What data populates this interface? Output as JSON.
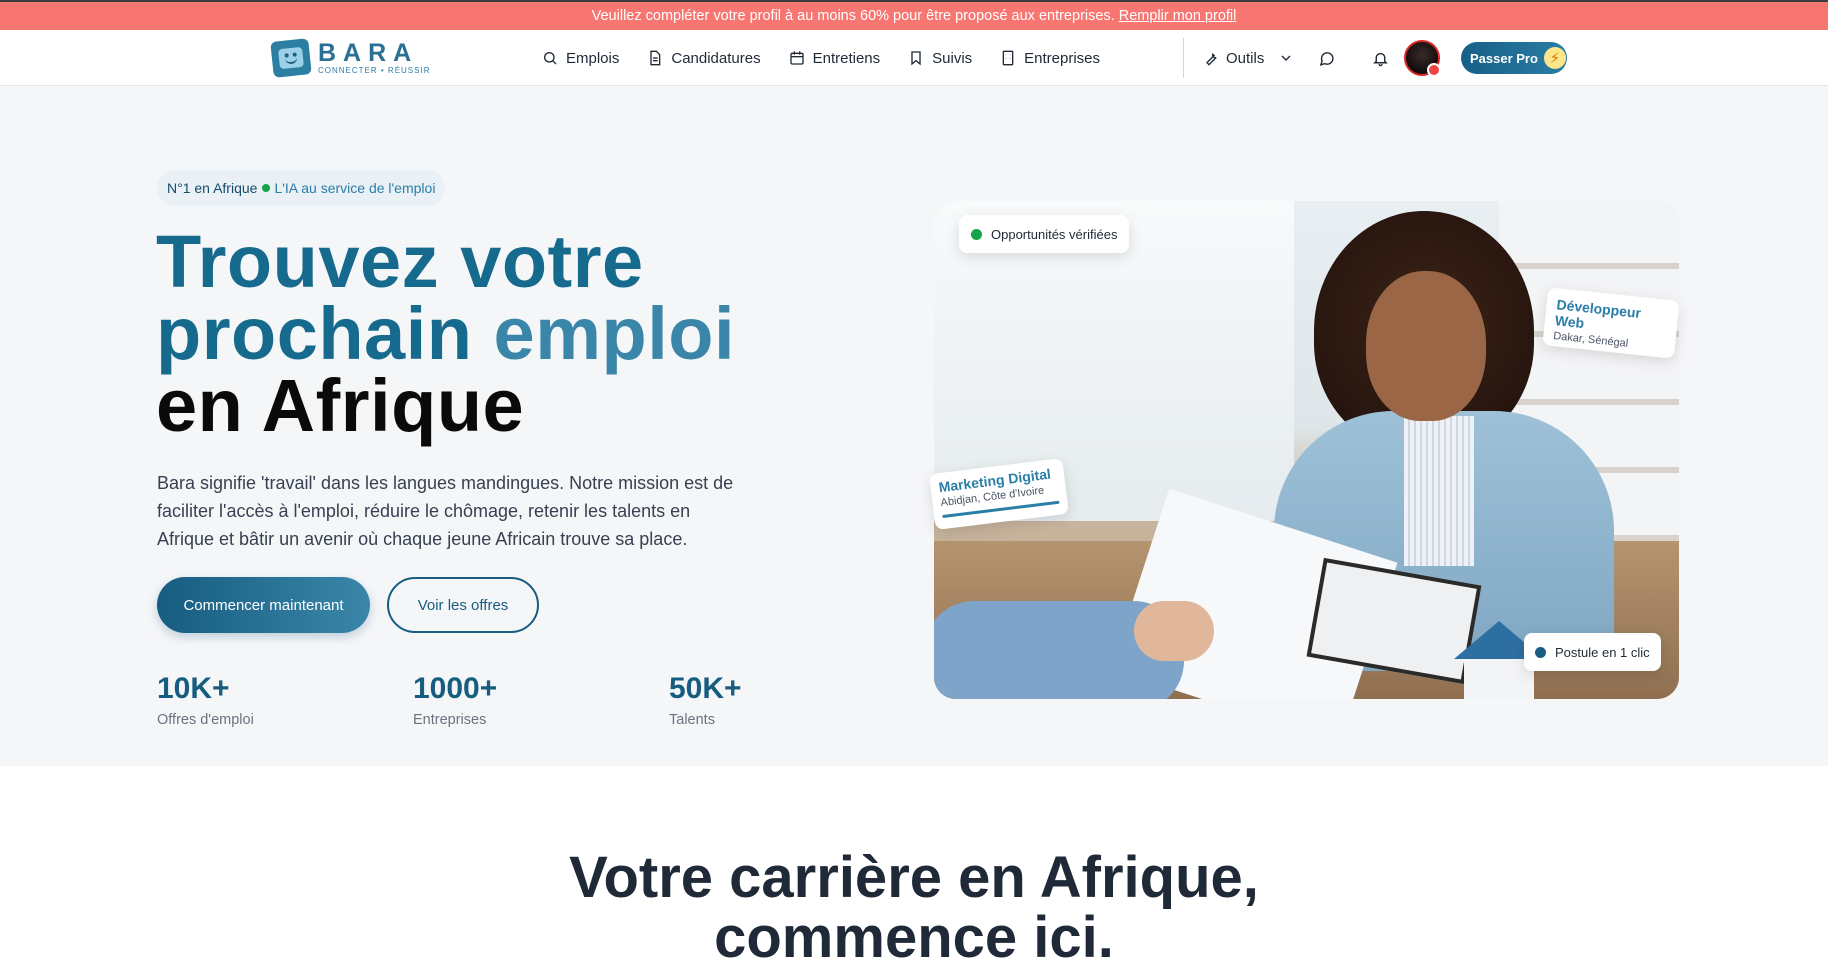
{
  "banner": {
    "text": "Veuillez compléter votre profil à au moins 60% pour être proposé aux entreprises.",
    "link": "Remplir mon profil",
    "color": "#f77672"
  },
  "header": {
    "logo": {
      "word": "BARA",
      "tagline": "CONNECTER • RÉUSSIR"
    },
    "nav": [
      {
        "label": "Emplois",
        "icon": "search-icon"
      },
      {
        "label": "Candidatures",
        "icon": "file-icon"
      },
      {
        "label": "Entretiens",
        "icon": "calendar-icon"
      },
      {
        "label": "Suivis",
        "icon": "bookmark-icon"
      },
      {
        "label": "Entreprises",
        "icon": "building-icon"
      }
    ],
    "tools": {
      "label": "Outils",
      "icon": "wrench-icon"
    },
    "pro_button": "Passer Pro",
    "accent": "#165d80"
  },
  "hero": {
    "pill": {
      "left": "N°1 en Afrique",
      "right": "L'IA au service de l'emploi"
    },
    "title": {
      "line1": "Trouvez votre",
      "line2a": "prochain",
      "line2b": "emploi",
      "line3": "en Afrique"
    },
    "description": "Bara signifie 'travail' dans les langues mandingues. Notre mission est de faciliter l'accès à l'emploi, réduire le chômage, retenir les talents en Afrique et bâtir un avenir où chaque jeune Africain trouve sa place.",
    "cta_primary": "Commencer maintenant",
    "cta_secondary": "Voir les offres",
    "stats": [
      {
        "value": "10K+",
        "label": "Offres d'emploi"
      },
      {
        "value": "1000+",
        "label": "Entreprises"
      },
      {
        "value": "50K+",
        "label": "Talents"
      }
    ],
    "image_tags": {
      "verified": "Opportunités vérifiées",
      "dev_title": "Développeur Web",
      "dev_location": "Dakar, Sénégal",
      "mkt_title": "Marketing Digital",
      "mkt_location": "Abidjan, Côte d'Ivoire",
      "apply": "Postule en 1 clic"
    }
  },
  "section2": {
    "title_line1": "Votre carrière en Afrique,",
    "title_line2": "commence ici."
  }
}
